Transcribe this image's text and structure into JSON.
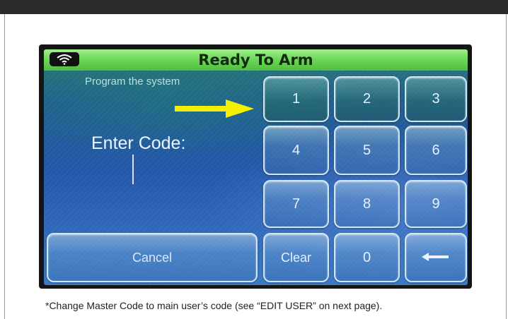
{
  "status_bar": {
    "title": "Ready To Arm",
    "wifi_icon": "wifi-icon"
  },
  "left_panel": {
    "program_text": "Program the system",
    "enter_code_label": "Enter Code:",
    "code_value": ""
  },
  "keypad": {
    "keys": [
      "1",
      "2",
      "3",
      "4",
      "5",
      "6",
      "7",
      "8",
      "9",
      "Clear",
      "0"
    ],
    "backspace_icon": "backspace-arrow-icon",
    "cancel_label": "Cancel"
  },
  "annotation": {
    "arrow_icon": "pointer-arrow-icon",
    "arrow_color": "#f4f000"
  },
  "caption": "*Change Master Code to main user’s code (see “EDIT USER” on next page).",
  "colors": {
    "status_bar_green": "#6fd85c",
    "screen_blue": "#2156a8",
    "screen_teal": "#2b7a6e"
  }
}
